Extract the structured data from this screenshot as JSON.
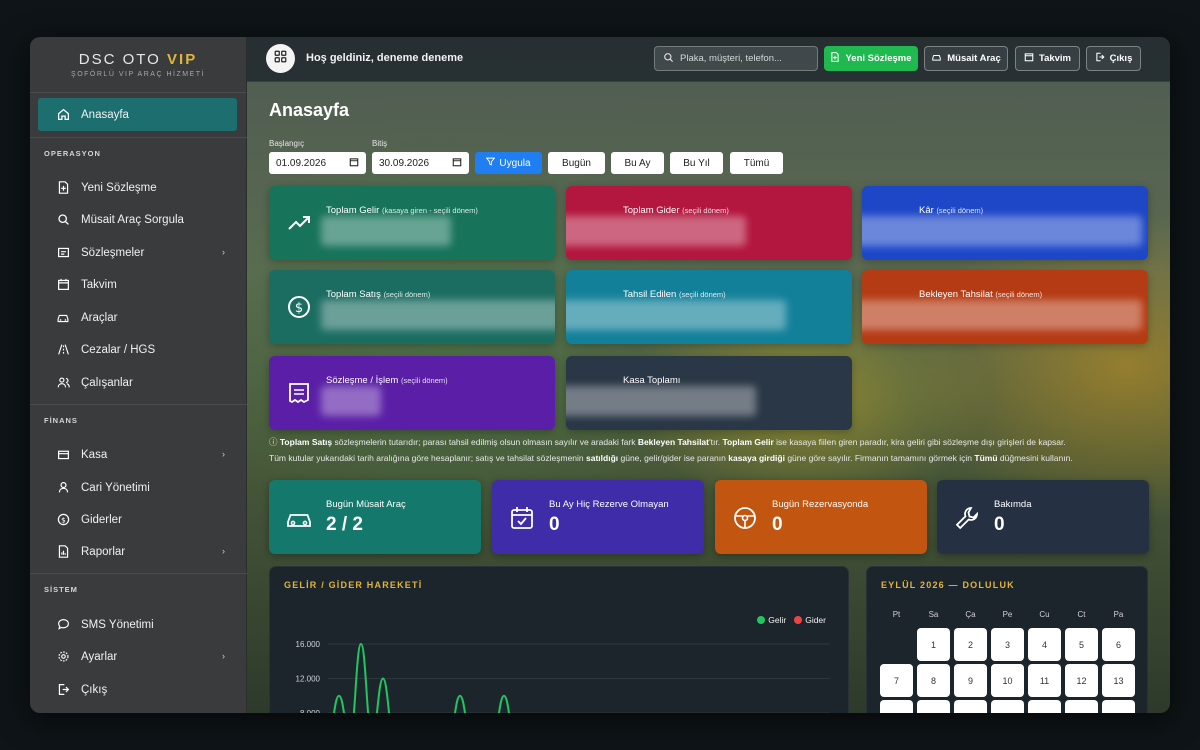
{
  "brand": {
    "name": "DSC OTO",
    "highlight": "VIP",
    "subtitle": "ŞOFÖRLÜ VIP ARAÇ HİZMETİ"
  },
  "sidebar": {
    "home": {
      "label": "Anasayfa",
      "icon": "home-icon"
    },
    "sections": [
      {
        "title": "OPERASYON",
        "items": [
          {
            "label": "Yeni Sözleşme",
            "icon": "document-plus-icon"
          },
          {
            "label": "Müsait Araç Sorgula",
            "icon": "search-icon"
          },
          {
            "label": "Sözleşmeler",
            "icon": "list-icon"
          },
          {
            "label": "Takvim",
            "icon": "calendar-icon"
          },
          {
            "label": "Araçlar",
            "icon": "car-icon"
          },
          {
            "label": "Cezalar / HGS",
            "icon": "road-icon"
          },
          {
            "label": "Çalışanlar",
            "icon": "users-icon"
          }
        ]
      },
      {
        "title": "FİNANS",
        "items": [
          {
            "label": "Kasa",
            "icon": "cashbox-icon"
          },
          {
            "label": "Cari Yönetimi",
            "icon": "user-icon"
          },
          {
            "label": "Giderler",
            "icon": "dollar-circle-icon"
          },
          {
            "label": "Raporlar",
            "icon": "report-icon"
          }
        ]
      },
      {
        "title": "SİSTEM",
        "items": [
          {
            "label": "SMS Yönetimi",
            "icon": "chat-icon"
          },
          {
            "label": "Ayarlar",
            "icon": "gear-icon"
          },
          {
            "label": "Çıkış",
            "icon": "logout-icon"
          }
        ]
      }
    ]
  },
  "topbar": {
    "welcome": "Hoş geldiniz, deneme deneme",
    "search_placeholder": "Plaka, müşteri, telefon...",
    "buttons": {
      "new_contract": "Yeni Sözleşme",
      "available_car": "Müsait Araç",
      "calendar": "Takvim",
      "logout": "Çıkış"
    }
  },
  "page": {
    "title": "Anasayfa"
  },
  "filters": {
    "start_label": "Başlangıç",
    "start_value": "01.09.2026",
    "end_label": "Bitiş",
    "end_value": "30.09.2026",
    "apply": "Uygula",
    "today": "Bugün",
    "this_month": "Bu Ay",
    "this_year": "Bu Yıl",
    "all": "Tümü"
  },
  "stats": [
    {
      "label": "Toplam Gelir",
      "sub": "(kasaya giren - seçili dönem)",
      "color": "#17735a",
      "icon": "trend-up-icon"
    },
    {
      "label": "Toplam Gider",
      "sub": "(seçili dönem)",
      "color": "#b3163e",
      "icon": "trend-down-icon"
    },
    {
      "label": "Kâr",
      "sub": "(seçili dönem)",
      "color": "#1d47c7",
      "icon": "chart-icon"
    },
    {
      "label": "Toplam Satış",
      "sub": "(seçili dönem)",
      "color": "#1b6d62",
      "icon": "dollar-circle-icon"
    },
    {
      "label": "Tahsil Edilen",
      "sub": "(seçili dönem)",
      "color": "#13809a",
      "icon": "hand-coin-icon"
    },
    {
      "label": "Bekleyen Tahsilat",
      "sub": "(seçili dönem)",
      "color": "#b53b14",
      "icon": "wallet-icon"
    },
    {
      "label": "Sözleşme / İşlem",
      "sub": "(seçili dönem)",
      "color": "#5a1fa6",
      "icon": "receipt-icon"
    },
    {
      "label": "Kasa Toplamı",
      "sub": "",
      "color": "#2a3746",
      "icon": "cashbox-icon"
    }
  ],
  "note": {
    "line1_parts": [
      "ⓘ ",
      "Toplam Satış",
      " sözleşmelerin tutarıdır; parası tahsil edilmiş olsun olmasın sayılır ve aradaki fark ",
      "Bekleyen Tahsilat",
      "'tır. ",
      "Toplam Gelir",
      " ise kasaya fiilen giren paradır, kira geliri gibi sözleşme dışı girişleri de kapsar."
    ],
    "line2_parts": [
      "Tüm kutular yukarıdaki tarih aralığına göre hesaplanır; satış ve tahsilat sözleşmenin ",
      "satıldığı",
      " güne, gelir/gider ise paranın ",
      "kasaya girdiği",
      " güne göre sayılır. Firmanın tamamını görmek için ",
      "Tümü",
      " düğmesini kullanın."
    ]
  },
  "kpis": [
    {
      "label": "Bugün Müsait Araç",
      "value": "2 / 2",
      "color": "#14796c",
      "icon": "car-icon"
    },
    {
      "label": "Bu Ay Hiç Rezerve Olmayan",
      "value": "0",
      "color": "#3e2ca8",
      "icon": "calendar-check-icon"
    },
    {
      "label": "Bugün Rezervasyonda",
      "value": "0",
      "color": "#c2550f",
      "icon": "steering-wheel-icon"
    },
    {
      "label": "Bakımda",
      "value": "0",
      "color": "#253142",
      "icon": "wrench-icon"
    }
  ],
  "income_panel": {
    "title": "GELİR / GİDER HAREKETİ",
    "legend": [
      {
        "name": "Gelir",
        "color": "#22c55e"
      },
      {
        "name": "Gider",
        "color": "#ef4444"
      }
    ]
  },
  "chart_data": {
    "type": "line",
    "title": "GELİR / GİDER HAREKETİ",
    "yticks": [
      "16.000",
      "12.000",
      "8.000"
    ],
    "series": [
      {
        "name": "Gelir",
        "color": "#22c55e",
        "peaks": [
          {
            "x": 1,
            "y": 10000
          },
          {
            "x": 3,
            "y": 16000
          },
          {
            "x": 5,
            "y": 12000
          },
          {
            "x": 12,
            "y": 10000
          },
          {
            "x": 16,
            "y": 10000
          }
        ]
      },
      {
        "name": "Gider",
        "color": "#ef4444",
        "peaks": []
      }
    ]
  },
  "calendar": {
    "title": "EYLÜL 2026 — DOLULUK",
    "weekdays": [
      "Pt",
      "Sa",
      "Ça",
      "Pe",
      "Cu",
      "Ct",
      "Pa"
    ],
    "week1": [
      "1",
      "2",
      "3",
      "4",
      "5",
      "6"
    ],
    "week2": [
      "7",
      "8",
      "9",
      "10",
      "11",
      "12",
      "13"
    ]
  }
}
